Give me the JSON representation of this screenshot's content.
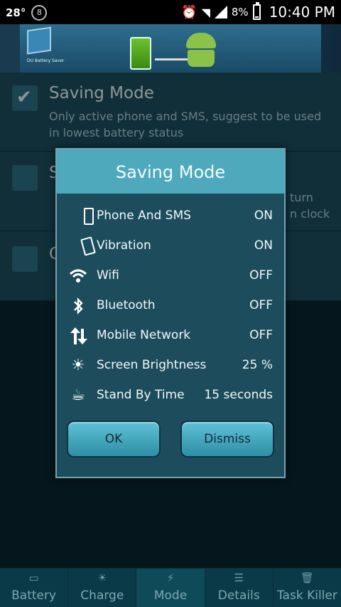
{
  "statusbar": {
    "temperature": "28°",
    "notif_count": "8",
    "battery": "8%",
    "time": "10:40 PM"
  },
  "banner": {
    "logo_text": "DU Battery Saver"
  },
  "list": {
    "items": [
      {
        "title": "Saving Mode",
        "desc": "Only active phone and SMS, suggest to be used in lowest battery status",
        "checked": true
      }
    ]
  },
  "dialog": {
    "title": "Saving Mode",
    "rows": [
      {
        "icon": "phone-icon",
        "label": "Phone And SMS",
        "value": "ON"
      },
      {
        "icon": "vibration-icon",
        "label": "Vibration",
        "value": "ON"
      },
      {
        "icon": "wifi-icon",
        "label": "Wifi",
        "value": "OFF"
      },
      {
        "icon": "bluetooth-icon",
        "label": "Bluetooth",
        "value": "OFF"
      },
      {
        "icon": "mobile-network-icon",
        "label": "Mobile Network",
        "value": "OFF"
      },
      {
        "icon": "brightness-icon",
        "label": "Screen Brightness",
        "value": "25 %"
      },
      {
        "icon": "standby-icon",
        "label": "Stand By Time",
        "value": "15 seconds"
      }
    ],
    "ok_label": "OK",
    "dismiss_label": "Dismiss"
  },
  "behind_fragments": {
    "row2_title_char": "S",
    "row2_right_1": "turn",
    "row2_right_2": "n clock",
    "row3_title_char": "C"
  },
  "nav": {
    "items": [
      {
        "label": "Battery",
        "icon": "battery-icon"
      },
      {
        "label": "Charge",
        "icon": "charge-icon"
      },
      {
        "label": "Mode",
        "icon": "mode-icon",
        "active": true
      },
      {
        "label": "Details",
        "icon": "details-icon"
      },
      {
        "label": "Task Killer",
        "icon": "trash-icon"
      }
    ]
  },
  "colors": {
    "dialog_title_bg": "#4fa9bd",
    "button_bg": "#3fa7bd",
    "background": "#0a2530"
  }
}
